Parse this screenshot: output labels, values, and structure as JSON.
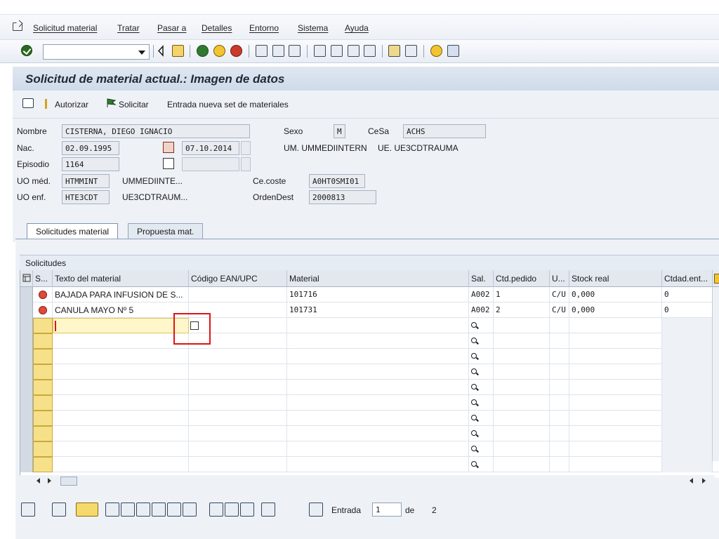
{
  "menu": {
    "items": [
      "Solicitud material",
      "Tratar",
      "Pasar a",
      "Detalles",
      "Entorno",
      "Sistema",
      "Ayuda"
    ]
  },
  "toolbar": {
    "command_value": ""
  },
  "title": "Solicitud de material actual.: Imagen de datos",
  "app_toolbar": {
    "authorize": "Autorizar",
    "request": "Solicitar",
    "new_entry": "Entrada nueva set de materiales"
  },
  "patient": {
    "name_label": "Nombre",
    "name_value": "CISTERNA, DIEGO IGNACIO",
    "sex_label": "Sexo",
    "sex_value": "M",
    "cesa_label": "CeSa",
    "cesa_value": "ACHS",
    "birth_label": "Nac.",
    "birth_value": "02.09.1995",
    "date_value": "07.10.2014",
    "um_text": "UM. UMMEDIINTERN",
    "ue_text": "UE. UE3CDTRAUMA",
    "episode_label": "Episodio",
    "episode_value": "1164",
    "uo_med_label": "UO méd.",
    "uo_med_value": "HTMMINT",
    "uo_med_desc": "UMMEDIINTE...",
    "cecoste_label": "Ce.coste",
    "cecoste_value": "A0HT0SMI01",
    "uo_enf_label": "UO enf.",
    "uo_enf_value": "HTE3CDT",
    "uo_enf_desc": "UE3CDTRAUM...",
    "orden_label": "OrdenDest",
    "orden_value": "2000813"
  },
  "tabs": [
    "Solicitudes material",
    "Propuesta mat."
  ],
  "group_title": "Solicitudes",
  "grid": {
    "headers": [
      "S...",
      "Texto del material",
      "Código EAN/UPC",
      "Material",
      "Sal.",
      "Ctd.pedido",
      "U...",
      "Stock real",
      "Ctdad.ent..."
    ],
    "rows": [
      {
        "texto": "BAJADA PARA INFUSION DE S...",
        "ean": "",
        "material": "101716",
        "sal": "A002",
        "ctd": "1",
        "u": "C/U",
        "stock": "0,000",
        "ent": "0"
      },
      {
        "texto": "CANULA MAYO Nº 5",
        "ean": "",
        "material": "101731",
        "sal": "A002",
        "ctd": "2",
        "u": "C/U",
        "stock": "0,000",
        "ent": "0"
      }
    ]
  },
  "pager": {
    "entry_label": "Entrada",
    "entry_value": "1",
    "of_label": "de",
    "total": "2"
  }
}
